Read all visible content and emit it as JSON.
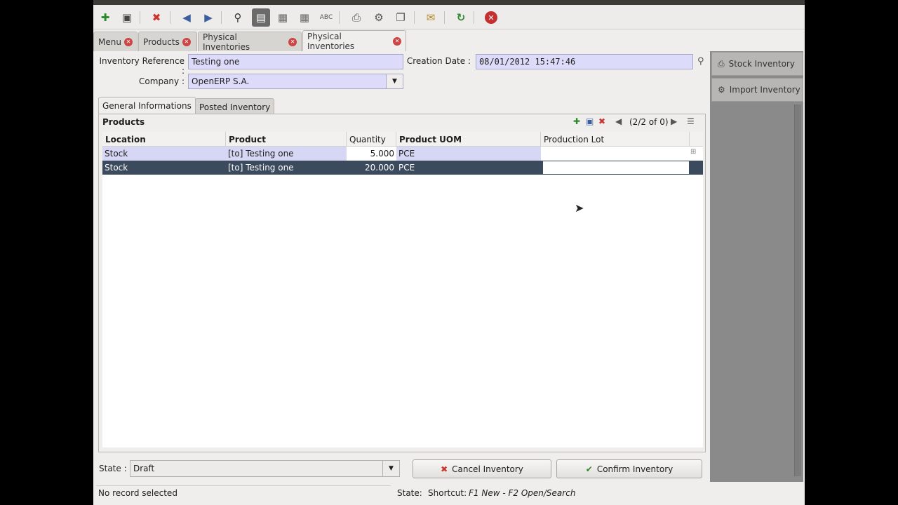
{
  "toolbar": {
    "buttons": [
      "new-icon",
      "save-icon",
      "delete-icon",
      "previous-icon",
      "next-icon",
      "find-icon",
      "form-view-icon",
      "list-view-icon",
      "calendar-view-icon",
      "spellcheck-icon",
      "print-icon",
      "action-icon",
      "attachment-icon",
      "request-icon",
      "reload-icon",
      "close-icon"
    ]
  },
  "tabs": [
    {
      "label": "Menu"
    },
    {
      "label": "Products"
    },
    {
      "label": "Physical Inventories"
    },
    {
      "label": "Physical Inventories"
    }
  ],
  "form": {
    "reference_label": "Inventory Reference :",
    "reference_value": "Testing one",
    "creation_label": "Creation Date :",
    "creation_value": "08/01/2012 15:47:46",
    "company_label": "Company :",
    "company_value": "OpenERP S.A."
  },
  "notebook": {
    "tab1": "General Informations",
    "tab2": "Posted Inventory"
  },
  "products": {
    "title": "Products",
    "pager": "(2/2 of 0)",
    "columns": [
      "Location",
      "Product",
      "Quantity",
      "Product UOM",
      "Production Lot"
    ],
    "rows": [
      {
        "location": "Stock",
        "product": "[to] Testing one",
        "quantity": "5.000",
        "uom": "PCE",
        "lot": ""
      },
      {
        "location": "Stock",
        "product": "[to] Testing one",
        "quantity": "20.000",
        "uom": "PCE",
        "lot": ""
      }
    ]
  },
  "state": {
    "label": "State :",
    "value": "Draft"
  },
  "buttons": {
    "cancel": "Cancel Inventory",
    "confirm": "Confirm Inventory"
  },
  "sidebar": {
    "items": [
      {
        "label": "Stock Inventory"
      },
      {
        "label": "Import Inventory"
      }
    ]
  },
  "status": {
    "left": "No record selected",
    "state_label": "State:",
    "shortcut_label": "Shortcut:",
    "shortcut_value": "F1 New - F2 Open/Search"
  },
  "colors": {
    "field_bg": "#dcdcfa",
    "row1_bg": "#d6d6f5",
    "row2_bg": "#3c4a5e"
  }
}
